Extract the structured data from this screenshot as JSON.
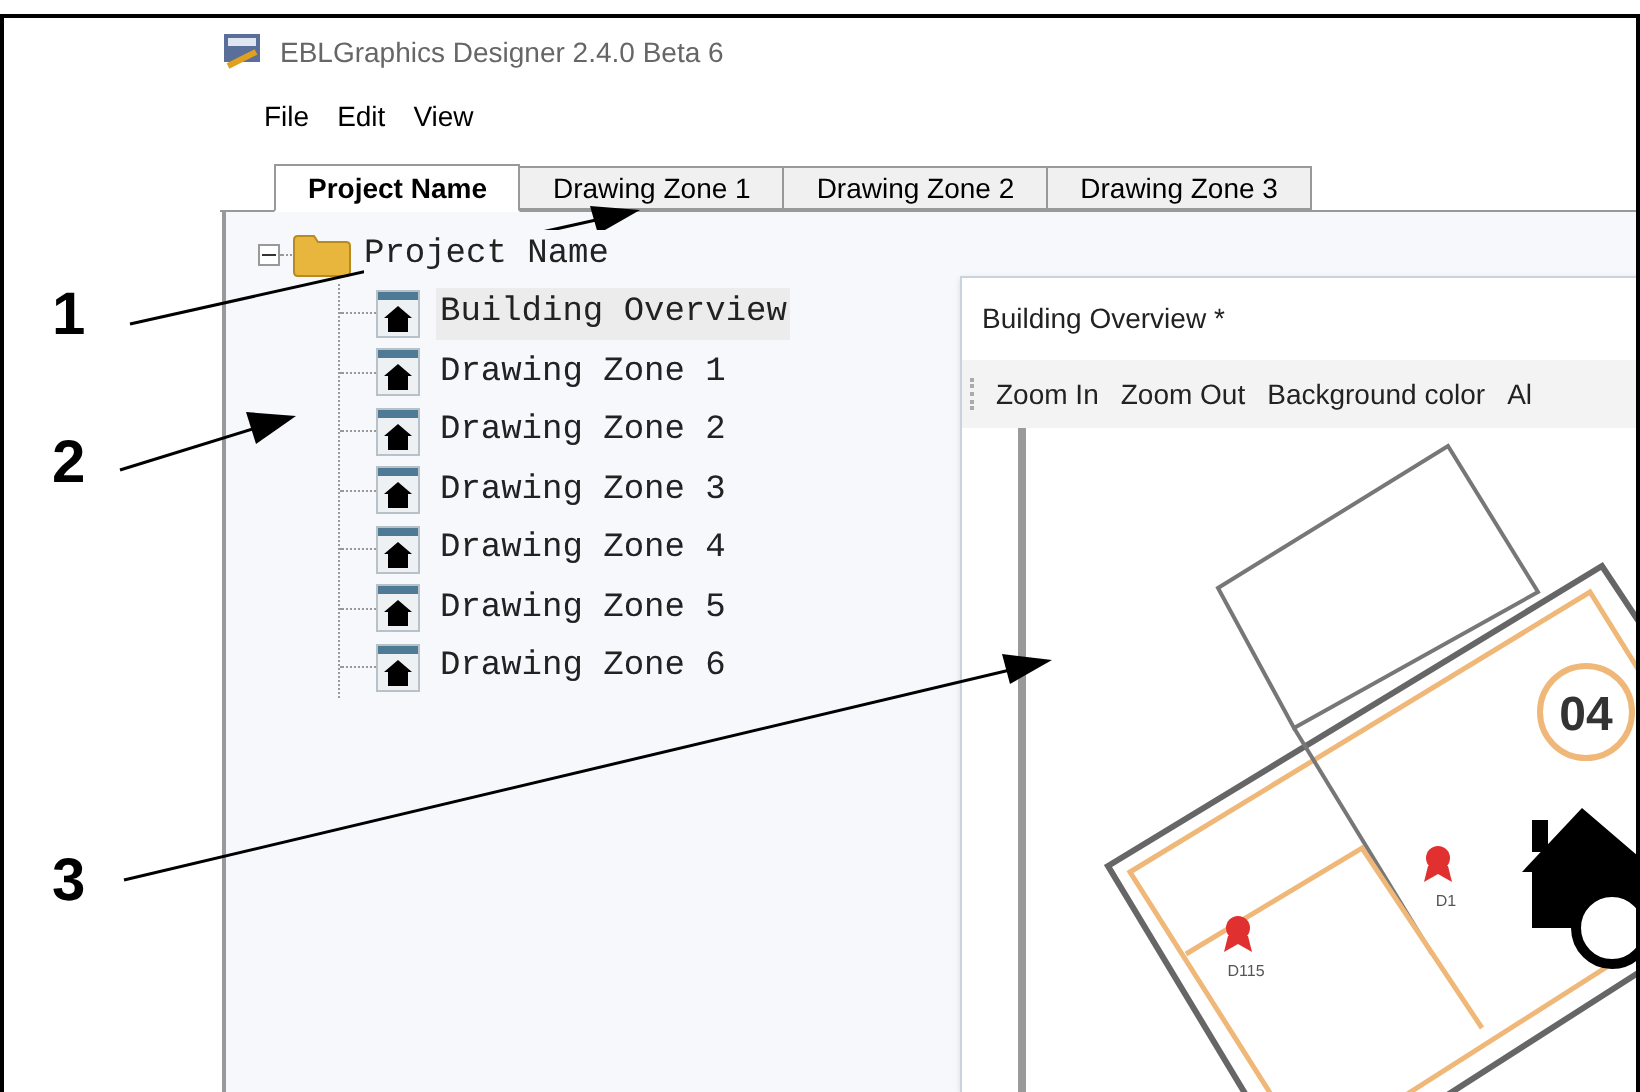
{
  "window": {
    "title": "EBLGraphics Designer 2.4.0 Beta 6"
  },
  "menu": [
    "File",
    "Edit",
    "View"
  ],
  "tabs": [
    {
      "label": "Project Name",
      "selected": true
    },
    {
      "label": "Drawing Zone 1",
      "selected": false
    },
    {
      "label": "Drawing Zone 2",
      "selected": false
    },
    {
      "label": "Drawing Zone 3",
      "selected": false
    }
  ],
  "tree": {
    "label": "Project Name",
    "expanded": true,
    "children": [
      {
        "label": "Building Overview",
        "selected": true
      },
      {
        "label": "Drawing Zone 1",
        "selected": false
      },
      {
        "label": "Drawing Zone 2",
        "selected": false
      },
      {
        "label": "Drawing Zone 3",
        "selected": false
      },
      {
        "label": "Drawing Zone 4",
        "selected": false
      },
      {
        "label": "Drawing Zone 5",
        "selected": false
      },
      {
        "label": "Drawing Zone 6",
        "selected": false
      }
    ]
  },
  "document": {
    "title": "Building Overview *",
    "toolbar": [
      "Zoom In",
      "Zoom Out",
      "Background color",
      "Al"
    ]
  },
  "floor_plan": {
    "room_number": "04",
    "markers": [
      {
        "label": "D115"
      },
      {
        "label": "D1"
      }
    ]
  },
  "callouts": [
    "1",
    "2",
    "3"
  ]
}
